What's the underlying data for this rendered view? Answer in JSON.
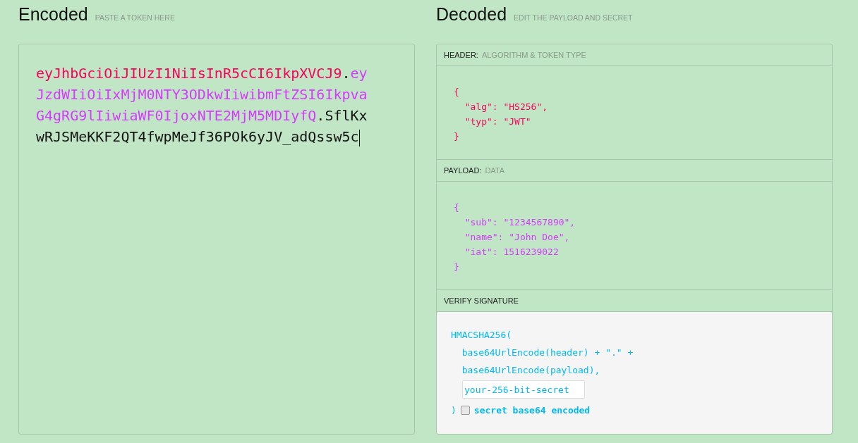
{
  "encoded": {
    "title": "Encoded",
    "subtitle": "PASTE A TOKEN HERE",
    "token": [
      {
        "kind": "header",
        "text": "eyJhbGciOiJIUzI1NiIsInR5cCI6IkpXVCJ9"
      },
      {
        "kind": "dot",
        "text": "."
      },
      {
        "kind": "payload",
        "text": "eyJzdWIiOiIxMjM0NTY3ODkwIiwibmFtZSI6IkpvaG4gRG9lIiwiaWF0IjoxNTE2MjM5MDIyfQ"
      },
      {
        "kind": "dot",
        "text": "."
      },
      {
        "kind": "signature",
        "text": "SflKxwRJSMeKKF2QT4fwpMeJf36POk6yJV_adQssw5c"
      }
    ]
  },
  "decoded": {
    "title": "Decoded",
    "subtitle": "EDIT THE PAYLOAD AND SECRET",
    "sections": [
      {
        "kind": "header",
        "label": "HEADER:",
        "sublabel": "ALGORITHM & TOKEN TYPE",
        "lines": [
          "{",
          "  \"alg\": \"HS256\",",
          "  \"typ\": \"JWT\"",
          "}"
        ]
      },
      {
        "kind": "payload",
        "label": "PAYLOAD:",
        "sublabel": "DATA",
        "lines": [
          "{",
          "  \"sub\": \"1234567890\",",
          "  \"name\": \"John Doe\",",
          "  \"iat\": 1516239022",
          "}"
        ]
      },
      {
        "kind": "signature",
        "label": "VERIFY SIGNATURE",
        "lines": [
          "HMACSHA256(",
          "  base64UrlEncode(header) + \".\" +",
          "  base64UrlEncode(payload),"
        ],
        "secret": {
          "value": "your-256-bit-secret"
        },
        "close": ")",
        "base64": {
          "label": "secret base64 encoded",
          "checked": false
        }
      }
    ]
  }
}
